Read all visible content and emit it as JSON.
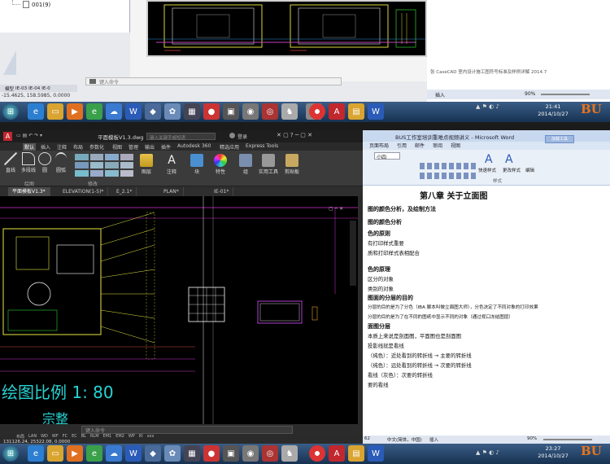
{
  "top": {
    "file_item": "001(9)",
    "layout_tabs": [
      "模型",
      "IE-03",
      "IE-04",
      "IE-0"
    ],
    "command_prompt": "键入命令",
    "coordinates": "-15.4625, 158.5985, 0.0000",
    "word_line": "张 CaseCAD 室内设计施工图符号标准及样例详解 2014.7",
    "word_insert": "插入",
    "zoom": "90%",
    "clock_time": "21:41",
    "clock_date": "2014/10/27"
  },
  "acad": {
    "title": "平面模板V1.3.dwg",
    "search_placeholder": "键入关键字或短语",
    "user": "登录",
    "menu_tabs": [
      "默认",
      "插入",
      "注释",
      "布局",
      "参数化",
      "视图",
      "管理",
      "输出",
      "插件",
      "Autodesk 360",
      "精选应用",
      "Express Tools"
    ],
    "draw_tools": [
      "直线",
      "多段线",
      "圆",
      "圆弧"
    ],
    "panel_draw": "绘图",
    "panel_modify": "修改",
    "tools": [
      "图层",
      "注释",
      "块",
      "特性",
      "组",
      "实用工具",
      "剪贴板"
    ],
    "doc_tabs": [
      "平面模板V1.3*",
      "ELEVATION(1-5)*",
      "E_2.1*",
      "PLAN*",
      "IE-01*"
    ],
    "scale_text": "绘图比例 1: 80",
    "bottom_text": "宗整",
    "command_prompt": "键入命令",
    "layout_tabs": [
      "布局",
      "LAN",
      "WD",
      "WF",
      "FC",
      "EC",
      "BL",
      "RLM",
      "EM1",
      "EM2",
      "WP",
      "KI",
      "xxx"
    ],
    "coordinates": "131126.24, 25322.08, 0.0000"
  },
  "word": {
    "title": "BUS工作室培训重难点视频讲义 - Microsoft Word",
    "menu_tabs": [
      "页面布局",
      "引用",
      "邮件",
      "审阅",
      "视图"
    ],
    "font_size": "小四",
    "style_labels": [
      "快速样式",
      "更改样式",
      "编辑"
    ],
    "style_group": "样式",
    "quick_btn": "加载工具",
    "chapter_title": "第八章 关于立面图",
    "lines": [
      "图的颜色分析，及绘制方法",
      "图的颜色分析",
      "色的原则",
      "有打印样式重要",
      "质和打印样式表相配合",
      "色的原理",
      "区分的对象",
      "类别的对象",
      "图面的分层的目的",
      "分层的目的是为了分色（IBA 脚本叫做立面图大师），分色决定了不同对象的打印效果",
      "分层的目的是为了在不同的图纸中显示不同的对象（通过视口冻结图层）",
      "面图分层",
      "本质上来说是剖面图，平面图也是剖面图",
      "投影线就是看线",
      "（纯色）：近处看到的转折线 → 主要的转折线",
      "（纯色）：远处看到的转折线 → 次要的转折线",
      "看线（灰色）：次要的转折线",
      "要的看线"
    ],
    "status_lang": "中文(简体，中国)",
    "status_insert": "插入",
    "status_page": "62",
    "zoom": "90%"
  },
  "bottom": {
    "clock_time": "23:27",
    "clock_date": "2014/10/27"
  },
  "colors": {
    "taskbar": "#1f3d63",
    "acad_bg": "#000000",
    "ribbon": "#3b3b3b",
    "word_ribbon": "#dbe6f4",
    "cyan_text": "#27d3d3",
    "orange_logo": "#e8731a"
  }
}
